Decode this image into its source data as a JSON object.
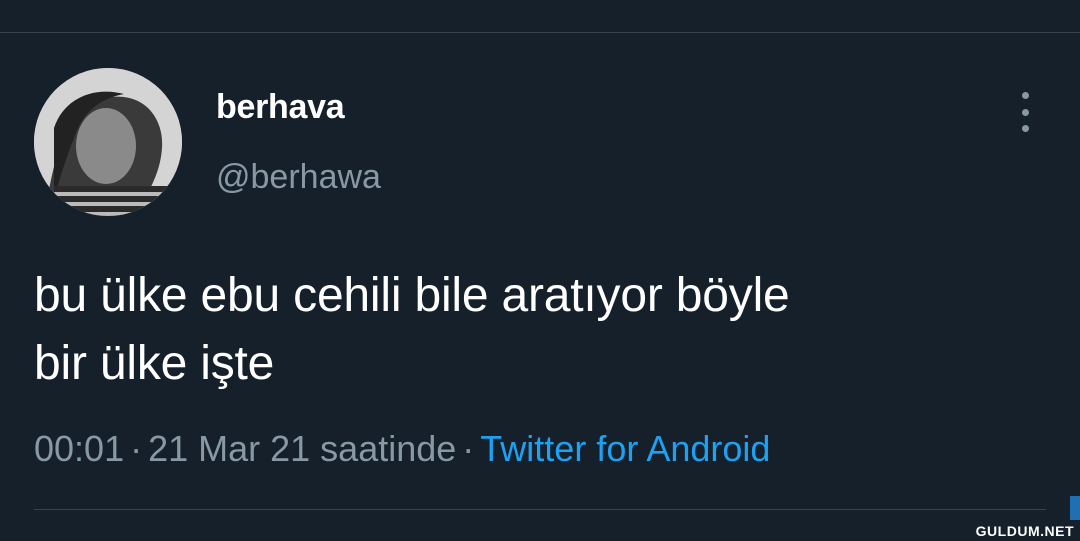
{
  "tweet": {
    "display_name": "berhava",
    "handle": "@berhawa",
    "text_line1": "bu ülke ebu cehili bile aratıyor böyle",
    "text_line2": "bir ülke işte",
    "time": "00:01",
    "separator": "·",
    "date": "21 Mar 21 saatinde",
    "source": "Twitter for Android"
  },
  "icons": {
    "more": "more-vertical-icon",
    "avatar": "avatar"
  },
  "watermark": "GULDUM.NET",
  "colors": {
    "background": "#15202b",
    "divider": "#38444d",
    "primary_text": "#ffffff",
    "secondary_text": "#8899a6",
    "link": "#1da1f2"
  }
}
